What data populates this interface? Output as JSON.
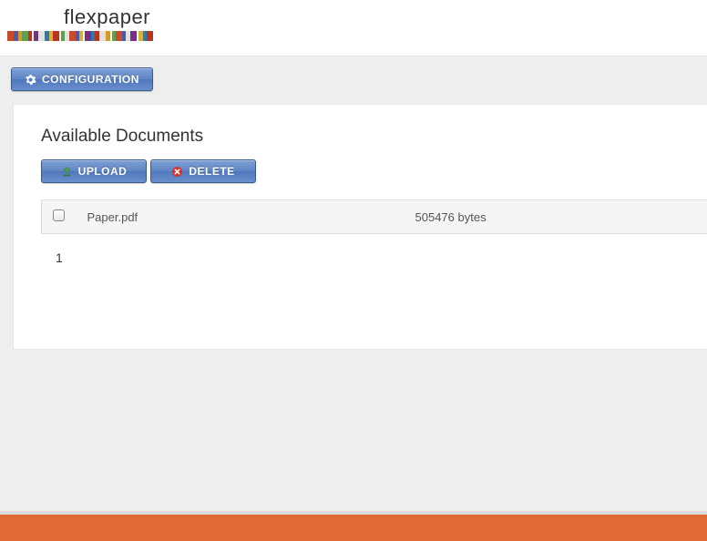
{
  "header": {
    "brand": "flexpaper"
  },
  "toolbar": {
    "configuration_label": "CONFIGURATION"
  },
  "panel": {
    "title": "Available Documents",
    "upload_label": "UPLOAD",
    "delete_label": "DELETE"
  },
  "documents": [
    {
      "name": "Paper.pdf",
      "size": "505476 bytes"
    }
  ],
  "pagination": {
    "current": "1"
  },
  "barcode_colors": [
    "#c94b2a",
    "#4d5aa8",
    "#d49a2a",
    "#5f9f4f",
    "#b9341e",
    "#7a2e86",
    "#e1e1e1",
    "#2b79b3",
    "#d3b13c",
    "#b9341e",
    "#5f9f4f",
    "#e1e1e1",
    "#c94b2a",
    "#4d5aa8",
    "#d3b13c",
    "#7a2e86",
    "#2b79b3",
    "#b9341e",
    "#e1e1e1",
    "#d49a2a",
    "#5f9f4f",
    "#c94b2a",
    "#4d5aa8",
    "#e1e1e1",
    "#7a2e86",
    "#d3b13c",
    "#2b79b3",
    "#b9341e"
  ]
}
